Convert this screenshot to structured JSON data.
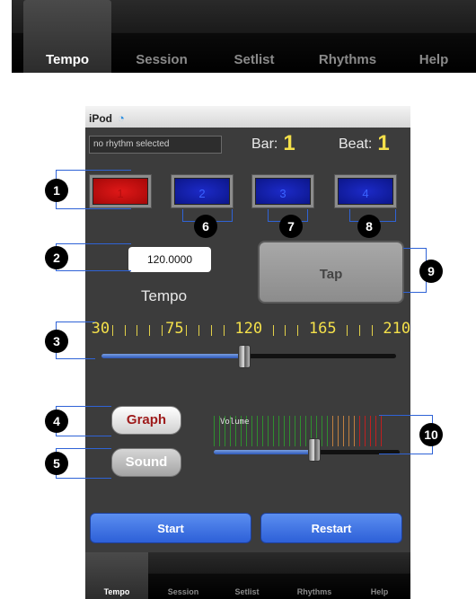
{
  "top_tabs": [
    "Tempo",
    "Session",
    "Setlist",
    "Rhythms",
    "Help"
  ],
  "status_bar": {
    "device": "iPod",
    "wifi_icon": "wifi-icon"
  },
  "rhythm_display": "no rhythm selected",
  "bar_counter": {
    "label": "Bar:",
    "value": "1"
  },
  "beat_counter": {
    "label": "Beat:",
    "value": "1"
  },
  "beats": [
    {
      "label": "1",
      "state": "active",
      "color": "#d01010"
    },
    {
      "label": "2",
      "state": "inactive",
      "color": "#1420b0"
    },
    {
      "label": "3",
      "state": "inactive",
      "color": "#1420b0"
    },
    {
      "label": "4",
      "state": "inactive",
      "color": "#1420b0"
    }
  ],
  "tempo": {
    "value": "120.0000",
    "label": "Tempo"
  },
  "tap_button": "Tap",
  "tempo_slider": {
    "scale_labels": [
      "30",
      "75",
      "120",
      "165",
      "210"
    ],
    "min": 30,
    "max": 210,
    "value": 120
  },
  "graph_button": "Graph",
  "sound_button": "Sound",
  "volume": {
    "label": "Volume",
    "level": 0.55
  },
  "start_button": "Start",
  "restart_button": "Restart",
  "bottom_tabs": [
    "Tempo",
    "Session",
    "Setlist",
    "Rhythms",
    "Help"
  ],
  "callouts": [
    "1",
    "2",
    "3",
    "4",
    "5",
    "6",
    "7",
    "8",
    "9",
    "10"
  ],
  "colors": {
    "accent_yellow": "#f4e04a",
    "button_blue": "#2d60d8",
    "callout_line": "#2f63d6"
  }
}
